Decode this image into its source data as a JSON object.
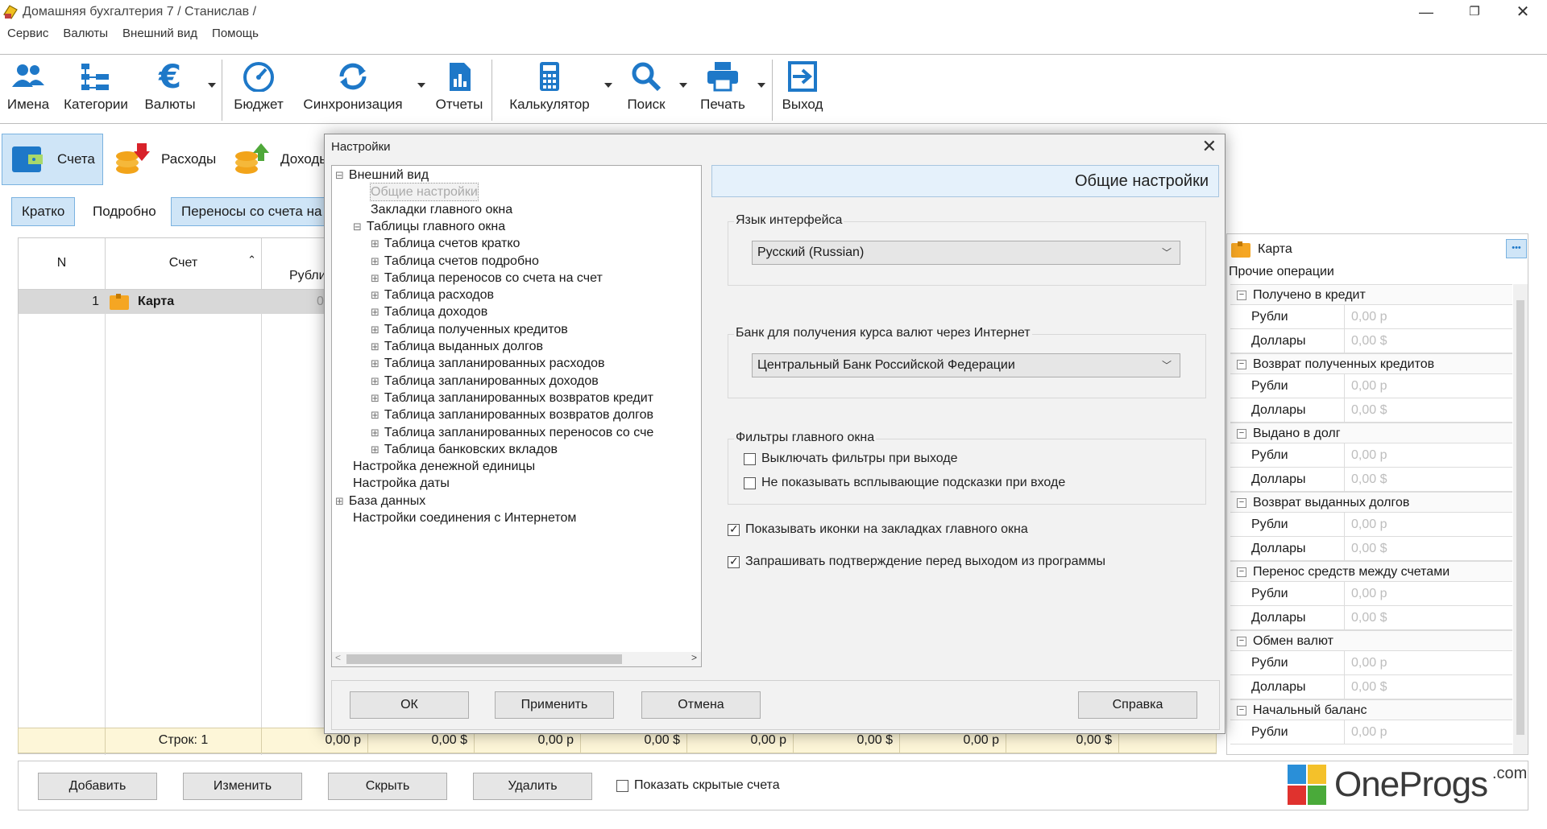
{
  "window": {
    "title": "Домашняя бухгалтерия 7  / Станислав /"
  },
  "menu": [
    "Сервис",
    "Валюты",
    "Внешний вид",
    "Помощь"
  ],
  "toolbar": {
    "names": "Имена",
    "categories": "Категории",
    "currencies": "Валюты",
    "budget": "Бюджет",
    "sync": "Синхронизация",
    "reports": "Отчеты",
    "calculator": "Калькулятор",
    "search": "Поиск",
    "print": "Печать",
    "exit": "Выход"
  },
  "main_tabs": {
    "accounts": "Счета",
    "expenses": "Расходы",
    "income": "Доходы"
  },
  "sub_tabs": {
    "brief": "Кратко",
    "detailed": "Подробно",
    "transfers": "Переносы со счета на счет"
  },
  "grid": {
    "col_n": "N",
    "col_account": "Счет",
    "col_rub": "Рубли",
    "row": {
      "n": "1",
      "name": "Карта",
      "rub": "0"
    },
    "footer": {
      "rows": "Строк: 1",
      "totals": [
        "0,00 р",
        "0,00 $",
        "0,00 р",
        "0,00 $",
        "0,00 р",
        "0,00 $",
        "0,00 р",
        "0,00 $"
      ]
    }
  },
  "bottom": {
    "add": "Добавить",
    "edit": "Изменить",
    "hide": "Скрыть",
    "delete": "Удалить",
    "show_hidden": "Показать скрытые счета"
  },
  "right_panel": {
    "account": "Карта",
    "more": "•••",
    "other_ops": "Прочие операции",
    "rub": "Рубли",
    "usd": "Доллары",
    "rub_val": "0,00 р",
    "usd_val": "0,00 $",
    "sections": [
      "Получено в кредит",
      "Возврат полученных кредитов",
      "Выдано в долг",
      "Возврат выданных долгов",
      "Перенос средств между счетами",
      "Обмен валют",
      "Начальный баланс"
    ]
  },
  "dialog": {
    "title": "Настройки",
    "close": "✕",
    "tree": [
      "Внешний вид",
      "Общие настройки",
      "Закладки главного окна",
      "Таблицы главного окна",
      "Таблица счетов кратко",
      "Таблица счетов подробно",
      "Таблица переносов со счета на счет",
      "Таблица расходов",
      "Таблица доходов",
      "Таблица полученных кредитов",
      "Таблица выданных долгов",
      "Таблица запланированных расходов",
      "Таблица запланированных доходов",
      "Таблица запланированных возвратов кредит",
      "Таблица запланированных возвратов долгов",
      "Таблица запланированных переносов со сче",
      "Таблица банковских вкладов",
      "Настройка денежной единицы",
      "Настройка даты",
      "База данных",
      "Настройки соединения с Интернетом"
    ],
    "pane_title": "Общие настройки",
    "lang_label": "Язык интерфейса",
    "lang_value": "Русский (Russian)",
    "bank_label": "Банк для получения курса валют через Интернет",
    "bank_value": "Центральный Банк Российской Федерации",
    "filters_label": "Фильтры главного окна",
    "filter1": "Выключать фильтры при выходе",
    "filter2": "Не показывать всплывающие подсказки при входе",
    "opt_icons": "Показывать иконки на закладках главного окна",
    "opt_confirm": "Запрашивать подтверждение перед выходом из программы",
    "ok": "ОК",
    "apply": "Применить",
    "cancel": "Отмена",
    "help": "Справка"
  },
  "logo": {
    "text": "OneProgs",
    "suffix": ".com"
  },
  "colors": {
    "accent": "#1e78c8",
    "selected_tab": "#cfe5f7",
    "footer": "#fdf6d8"
  }
}
